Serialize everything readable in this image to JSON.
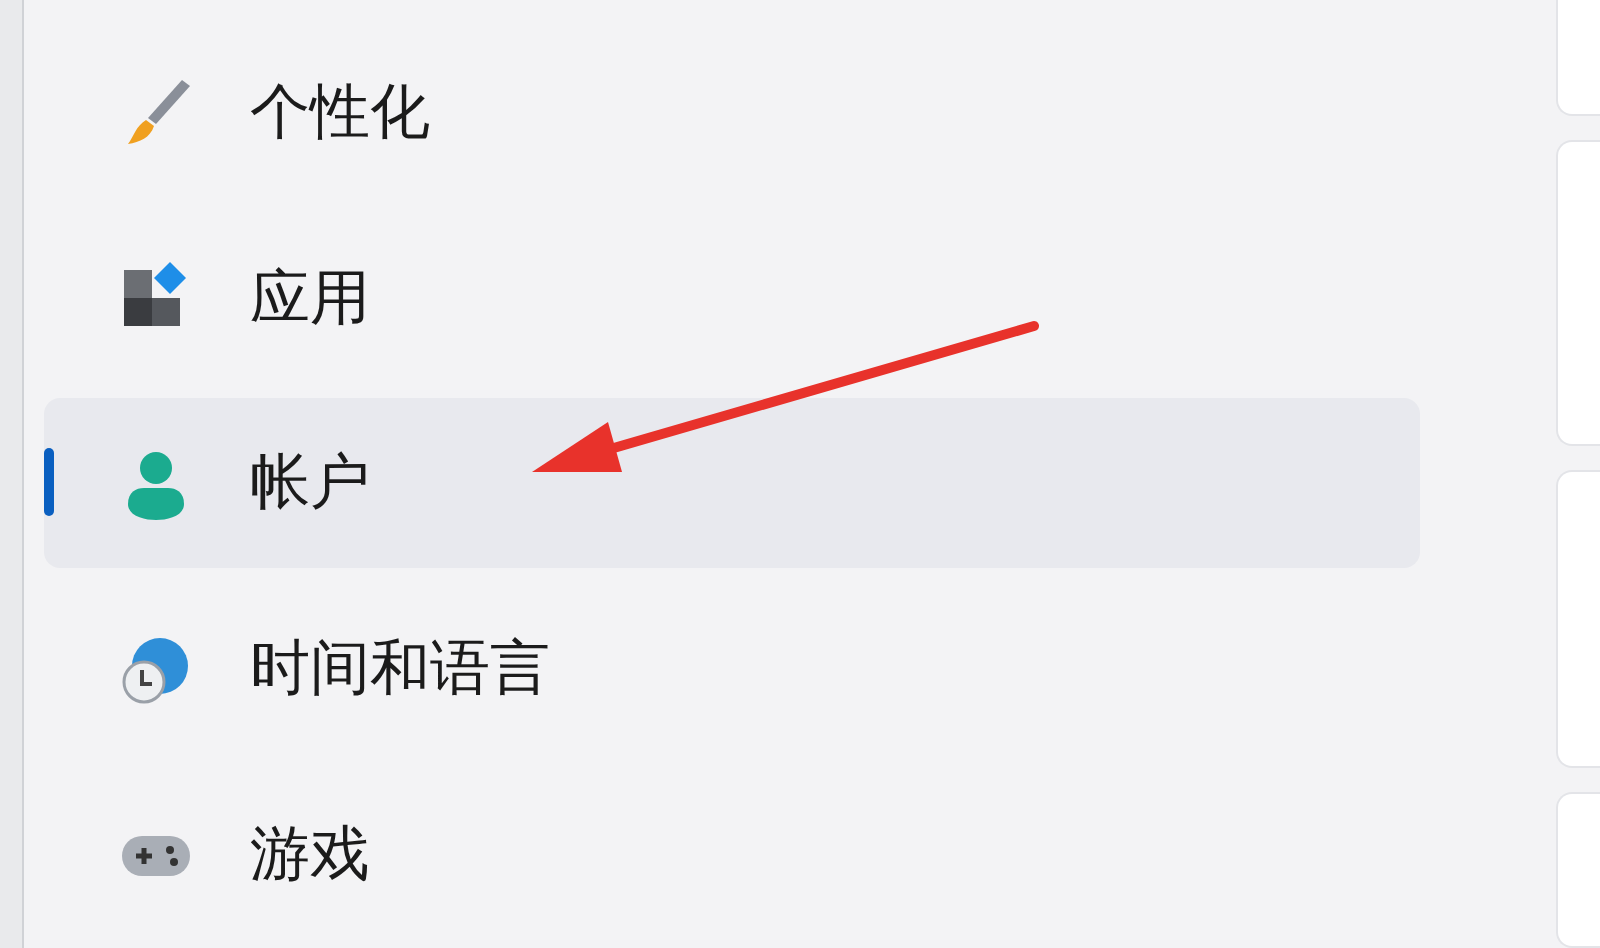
{
  "nav_items": [
    {
      "label": "个性化",
      "selected": false
    },
    {
      "label": "应用",
      "selected": false
    },
    {
      "label": "帐户",
      "selected": true
    },
    {
      "label": "时间和语言",
      "selected": false
    },
    {
      "label": "游戏",
      "selected": false
    }
  ],
  "annotation": {
    "kind": "arrow",
    "color": "#e8322b"
  }
}
